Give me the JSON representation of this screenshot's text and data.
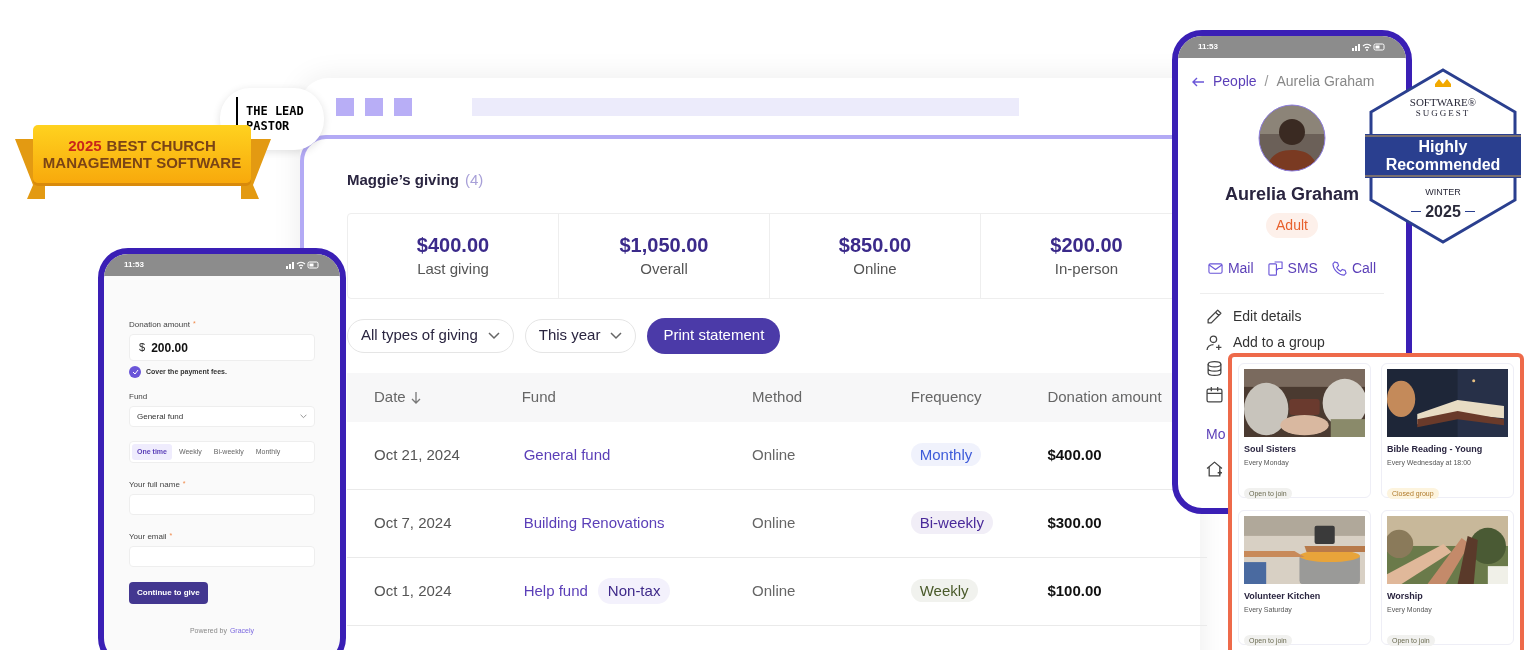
{
  "award_ribbon": {
    "year": "2025",
    "line1": "BEST CHURCH",
    "line2": "MANAGEMENT SOFTWARE"
  },
  "lead_pastor_badge": {
    "text": "THE LEAD PASTOR"
  },
  "dashboard": {
    "title": "Maggie’s giving",
    "count": "(4)",
    "stats": [
      {
        "value": "$400.00",
        "label": "Last giving"
      },
      {
        "value": "$1,050.00",
        "label": "Overall"
      },
      {
        "value": "$850.00",
        "label": "Online"
      },
      {
        "value": "$200.00",
        "label": "In-person"
      }
    ],
    "filters": [
      {
        "label": "All types of giving"
      },
      {
        "label": "This year"
      }
    ],
    "print_button": "Print statement",
    "columns": [
      {
        "label": "Date",
        "sorted": true
      },
      {
        "label": "Fund",
        "sorted": false
      },
      {
        "label": "Method",
        "sorted": false
      },
      {
        "label": "Frequency",
        "sorted": false
      },
      {
        "label": "Donation amount",
        "sorted": false
      }
    ],
    "rows": [
      {
        "date": "Oct 21, 2024",
        "fund": "General fund",
        "method": "Online",
        "frequency": {
          "label": "Monthly",
          "color": "#3d5bd9"
        },
        "amount": "$400.00"
      },
      {
        "date": "Oct 7, 2024",
        "fund": "Building Renovations",
        "method": "Online",
        "frequency": {
          "label": "Bi-weekly",
          "color": "#4a2a9a"
        },
        "amount": "$300.00"
      },
      {
        "date": "Oct 1, 2024",
        "fund": "Help fund",
        "tag": "Non-tax",
        "method": "Online",
        "frequency": {
          "label": "Weekly",
          "color": "#4a5a2a"
        },
        "amount": "$100.00"
      }
    ]
  },
  "donation_phone": {
    "time": "11:53",
    "amount_label": "Donation amount",
    "required_mark": "*",
    "currency": "$",
    "amount": "200.00",
    "cover_fees": {
      "label": "Cover the payment fees.",
      "checked": true
    },
    "fund_label": "Fund",
    "fund_value": "General fund",
    "frequency_options": [
      {
        "label": "One time",
        "selected": true
      },
      {
        "label": "Weekly",
        "selected": false
      },
      {
        "label": "Bi-weekly",
        "selected": false
      },
      {
        "label": "Monthly",
        "selected": false
      }
    ],
    "name_label": "Your full name",
    "email_label": "Your email",
    "continue_button": "Continue to give",
    "powered_by": "Powered by",
    "brand": "Gracely"
  },
  "profile_phone": {
    "time": "11:53",
    "breadcrumb": {
      "parent": "People",
      "separator": "/",
      "current": "Aurelia Graham"
    },
    "name": "Aurelia Graham",
    "tag": "Adult",
    "actions": [
      {
        "kind": "mail",
        "label": "Mail"
      },
      {
        "kind": "sms",
        "label": "SMS"
      },
      {
        "kind": "call",
        "label": "Call"
      }
    ],
    "menu": [
      {
        "kind": "pencil",
        "label": "Edit details"
      },
      {
        "kind": "person_add",
        "label": "Add to a group"
      },
      {
        "kind": "coins"
      },
      {
        "kind": "calendar"
      }
    ],
    "more_link": "Mo",
    "last_icon": {
      "kind": "home"
    }
  },
  "groups": [
    {
      "title": "Soul Sisters",
      "schedule": "Every Monday",
      "status": {
        "kind": "open",
        "label": "Open to join"
      }
    },
    {
      "title": "Bible Reading - Young",
      "schedule": "Every Wednesday at 18:00",
      "status": {
        "kind": "closed",
        "label": "Closed group"
      }
    },
    {
      "title": "Volunteer Kitchen",
      "schedule": "Every Saturday",
      "status": {
        "kind": "open",
        "label": "Open to join"
      }
    },
    {
      "title": "Worship",
      "schedule": "Every Monday",
      "status": {
        "kind": "open",
        "label": "Open to join"
      }
    }
  ],
  "recommendation_badge": {
    "brand_line1": "SOFTWARE®",
    "brand_line2": "SUGGEST",
    "title": "Highly Recommended",
    "season": "WINTER",
    "year": "2025"
  }
}
